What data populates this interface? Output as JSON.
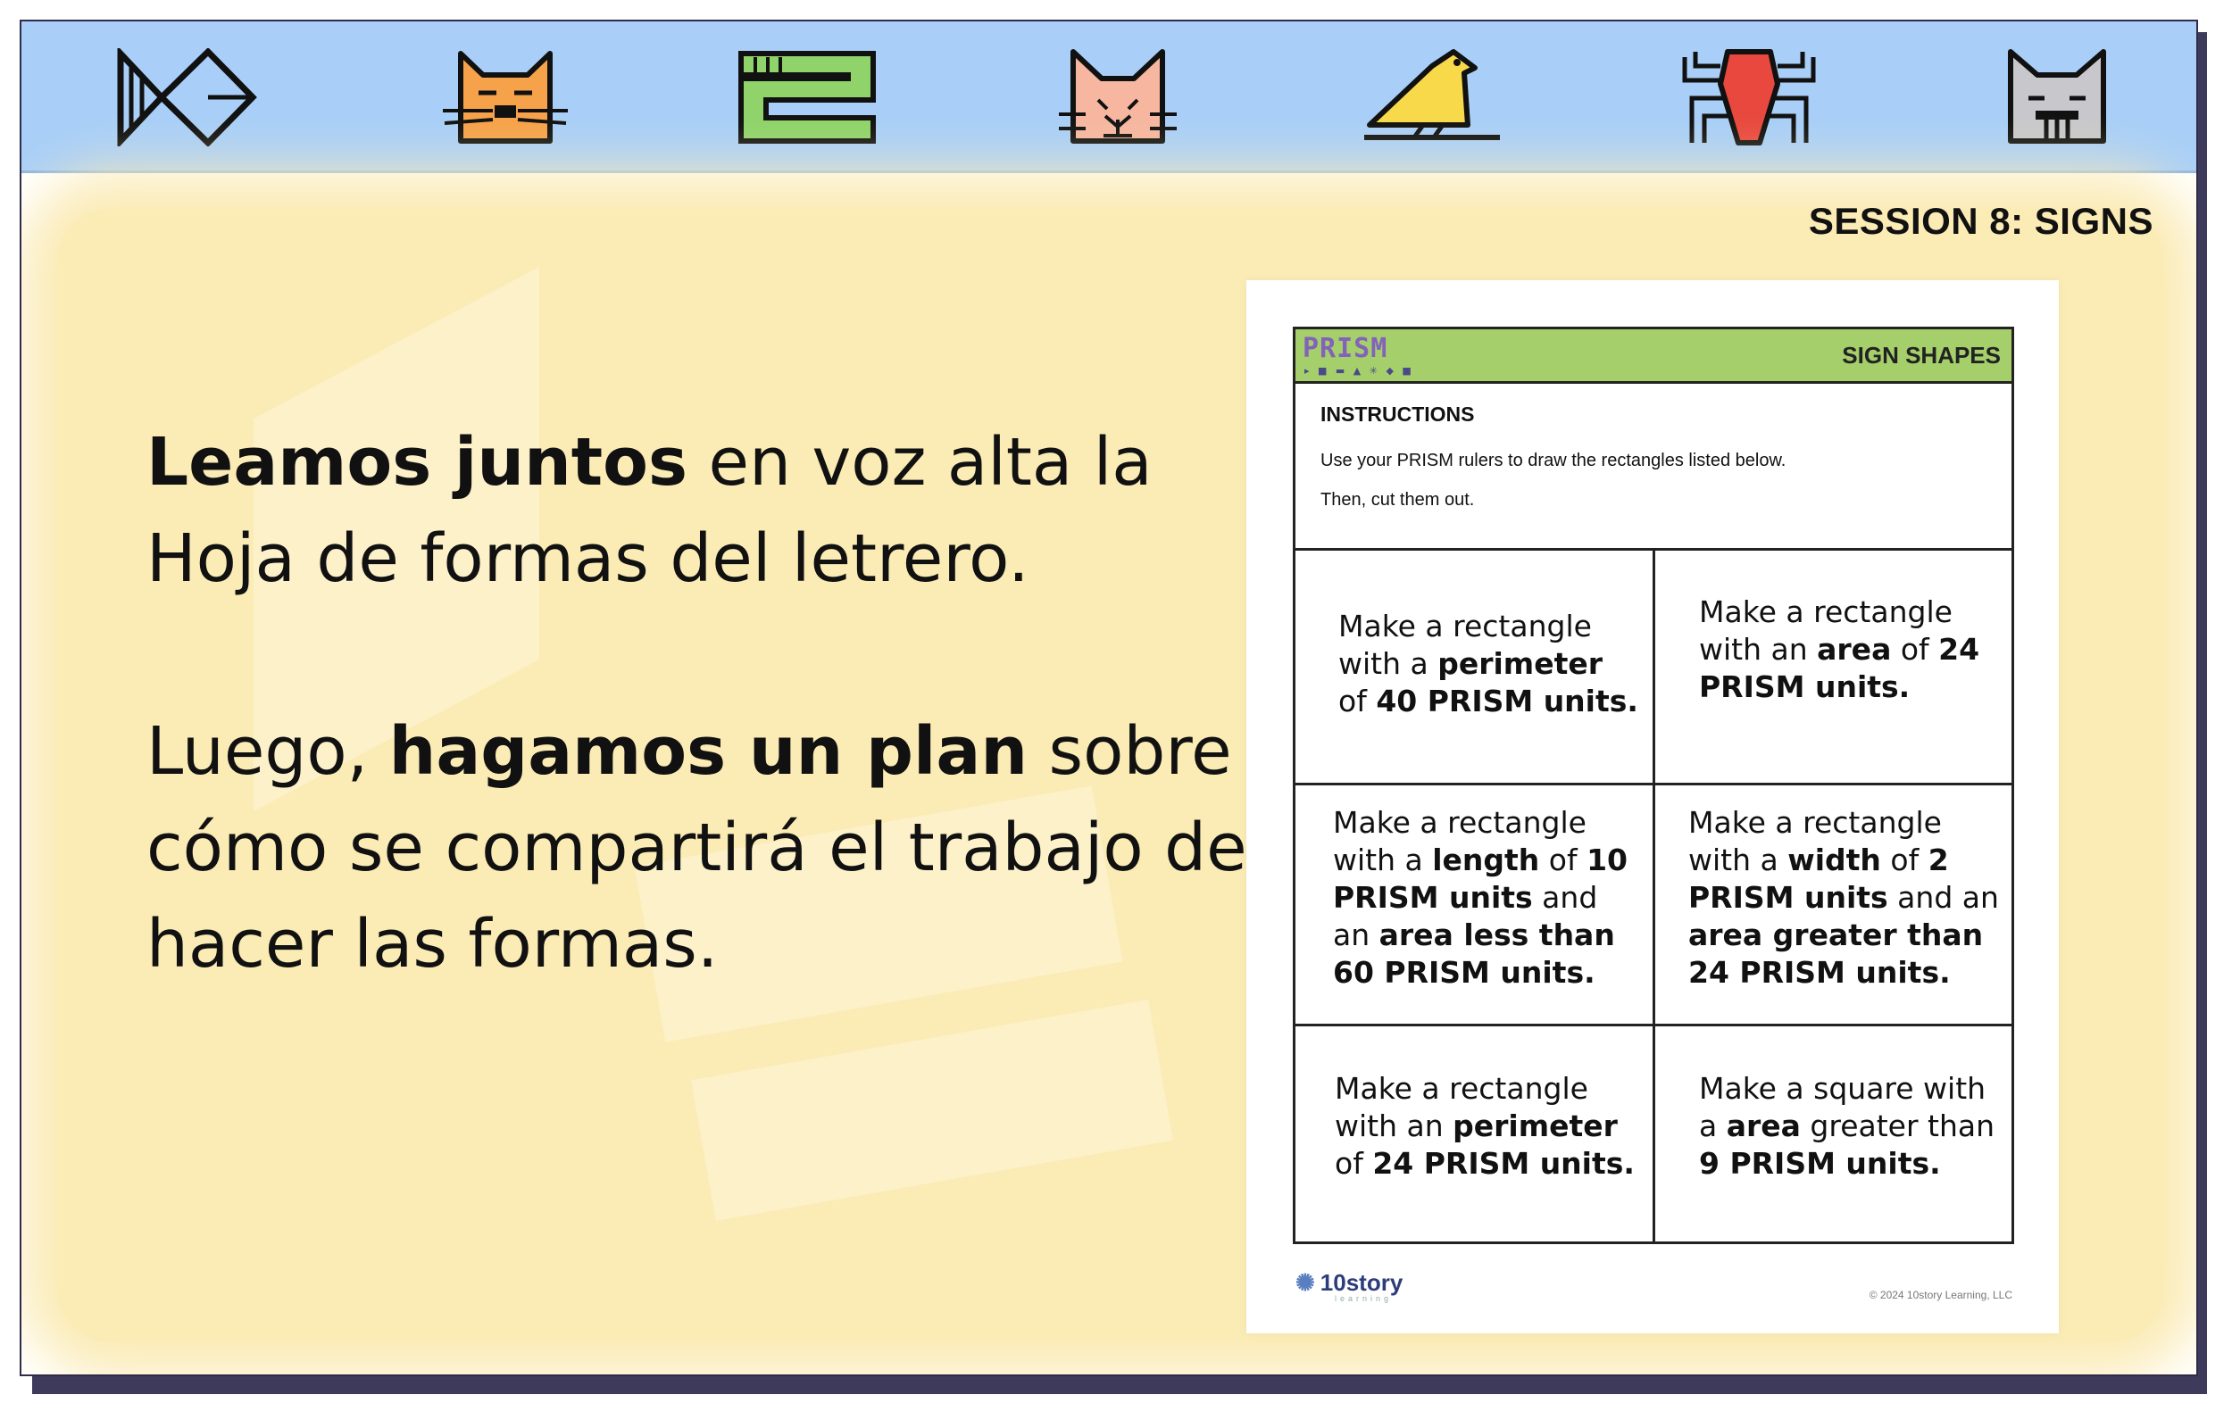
{
  "header": {
    "icons": [
      "fish-icon",
      "orange-cat-icon",
      "green-number-two-icon",
      "pink-cat-icon",
      "yellow-bird-icon",
      "red-spider-icon",
      "gray-cat-icon"
    ]
  },
  "session_label": "SESSION 8: SIGNS",
  "prompt": {
    "p1_bold": "Leamos juntos",
    "p1_rest": " en voz alta la Hoja de formas del letrero.",
    "p2_start": "Luego, ",
    "p2_bold": "hagamos un plan",
    "p2_rest": " sobre cómo se compartirá el trabajo de hacer las formas."
  },
  "worksheet": {
    "logo": "PRISM",
    "title": "SIGN SHAPES",
    "instructions_heading": "INSTRUCTIONS",
    "instructions_line1": "Use your PRISM rulers to draw the rectangles listed below.",
    "instructions_line2": "Then, cut them out.",
    "footer_logo": "10story",
    "footer_logo_sub": "learning",
    "copyright": "© 2024 10story Learning, LLC"
  },
  "colors": {
    "header_band": "#a9cff8",
    "background_glow": "#fbebb5",
    "worksheet_header": "#a4cf6a",
    "frame_shadow": "#3e3a5c"
  }
}
